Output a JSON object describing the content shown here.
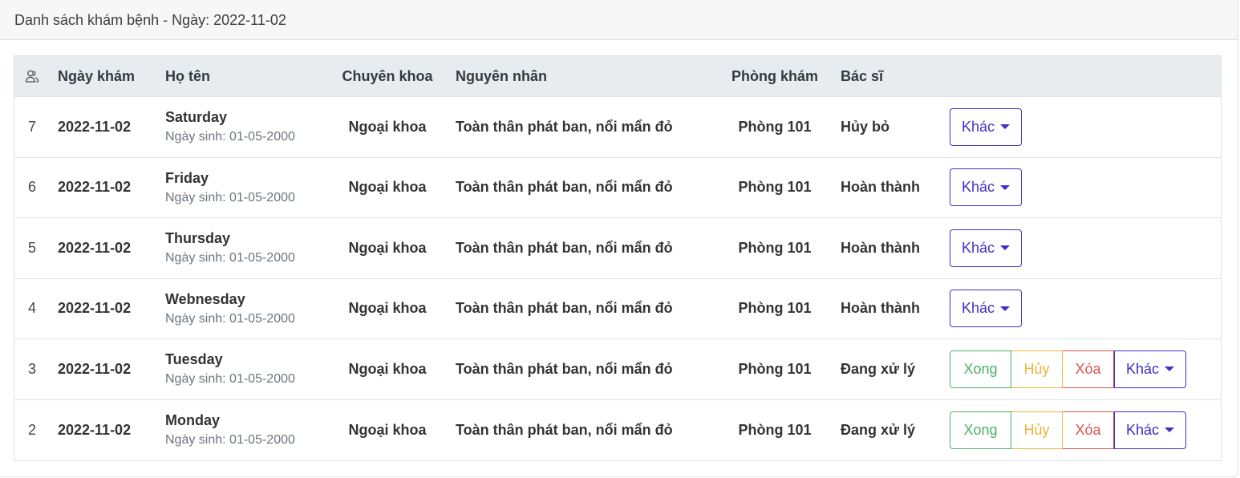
{
  "header": {
    "title": "Danh sách khám bệnh - Ngày: 2022-11-02"
  },
  "table": {
    "columns": {
      "icon": "users-icon",
      "date": "Ngày khám",
      "name": "Họ tên",
      "dept": "Chuyên khoa",
      "reason": "Nguyên nhân",
      "room": "Phòng khám",
      "status": "Bác sĩ"
    },
    "rows": [
      {
        "stt": "7",
        "date": "2022-11-02",
        "name": "Saturday",
        "dob": "Ngày sinh: 01-05-2000",
        "dept": "Ngoại khoa",
        "reason": "Toàn thân phát ban, nổi mẩn đỏ",
        "room": "Phòng 101",
        "status": "Hủy bỏ",
        "more": "Khác"
      },
      {
        "stt": "6",
        "date": "2022-11-02",
        "name": "Friday",
        "dob": "Ngày sinh: 01-05-2000",
        "dept": "Ngoại khoa",
        "reason": "Toàn thân phát ban, nổi mẩn đỏ",
        "room": "Phòng 101",
        "status": "Hoàn thành",
        "more": "Khác"
      },
      {
        "stt": "5",
        "date": "2022-11-02",
        "name": "Thursday",
        "dob": "Ngày sinh: 01-05-2000",
        "dept": "Ngoại khoa",
        "reason": "Toàn thân phát ban, nổi mẩn đỏ",
        "room": "Phòng 101",
        "status": "Hoàn thành",
        "more": "Khác"
      },
      {
        "stt": "4",
        "date": "2022-11-02",
        "name": "Webnesday",
        "dob": "Ngày sinh: 01-05-2000",
        "dept": "Ngoại khoa",
        "reason": "Toàn thân phát ban, nổi mẩn đỏ",
        "room": "Phòng 101",
        "status": "Hoàn thành",
        "more": "Khác"
      },
      {
        "stt": "3",
        "date": "2022-11-02",
        "name": "Tuesday",
        "dob": "Ngày sinh: 01-05-2000",
        "dept": "Ngoại khoa",
        "reason": "Toàn thân phát ban, nổi mẩn đỏ",
        "room": "Phòng 101",
        "status": "Đang xử lý",
        "done": "Xong",
        "cancel": "Hủy",
        "delete": "Xóa",
        "more": "Khác"
      },
      {
        "stt": "2",
        "date": "2022-11-02",
        "name": "Monday",
        "dob": "Ngày sinh: 01-05-2000",
        "dept": "Ngoại khoa",
        "reason": "Toàn thân phát ban, nổi mẩn đỏ",
        "room": "Phòng 101",
        "status": "Đang xử lý",
        "done": "Xong",
        "cancel": "Hủy",
        "delete": "Xóa",
        "more": "Khác"
      }
    ]
  },
  "colors": {
    "more": "#3d2fc9",
    "done": "#4caf6a",
    "cancel": "#f0b43a",
    "delete": "#d9534f",
    "header_bg": "#e9ecef"
  }
}
